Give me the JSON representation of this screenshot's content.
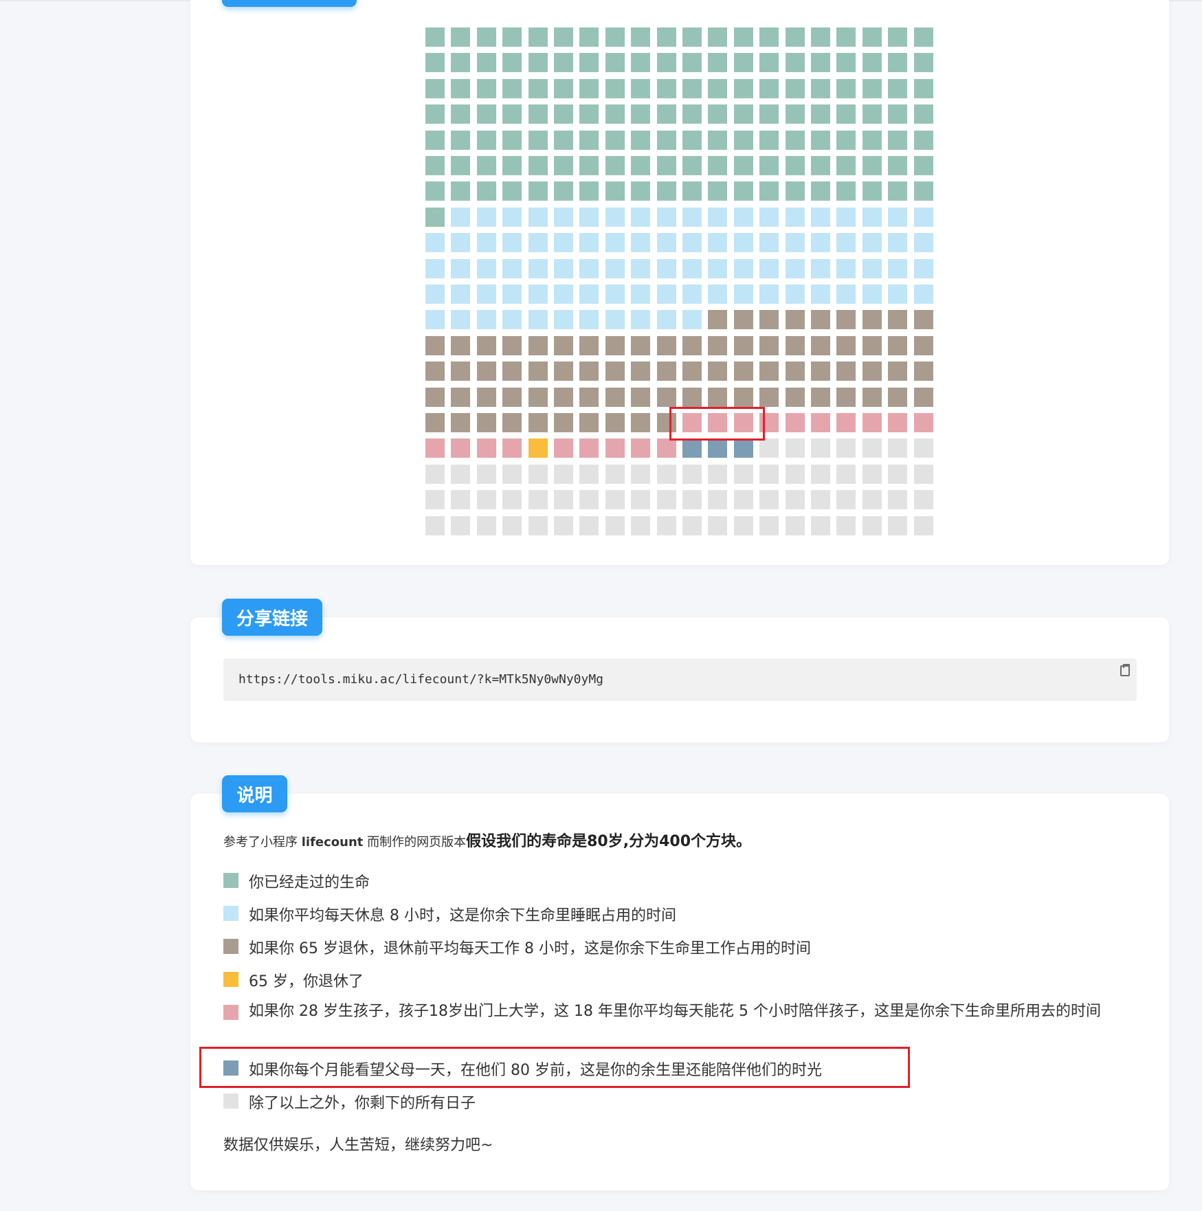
{
  "share": {
    "title": "分享链接",
    "url": "https://tools.miku.ac/lifecount/?k=MTk5Ny0wNy0yMg"
  },
  "description": {
    "title": "说明",
    "intro_prefix": "参考了小程序 ",
    "intro_app": "lifecount",
    "intro_middle": " 而制作的网页版本",
    "intro_strong": "假设我们的寿命是80岁,分为400个方块。",
    "legend": [
      {
        "label": "你已经走过的生命",
        "color": "#97c3b6"
      },
      {
        "label": "如果你平均每天休息 8 小时，这是你余下生命里睡眠占用的时间",
        "color": "#c0e5f6"
      },
      {
        "label": "如果你 65 岁退休，退休前平均每天工作 8 小时，这是你余下生命里工作占用的时间",
        "color": "#a99b8e"
      },
      {
        "label": "65 岁，你退休了",
        "color": "#f7bd3b"
      },
      {
        "label": "如果你 28 岁生孩子，孩子18岁出门上大学，这 18 年里你平均每天能花 5 个小时陪伴孩子，这里是你余下生命里所用去的时间",
        "color": "#e4a6ac"
      },
      {
        "label": "如果你每个月能看望父母一天，在他们 80 岁前，这是你的余生里还能陪伴他们的时光",
        "color": "#7c9db3"
      },
      {
        "label": "除了以上之外，你剩下的所有日子",
        "color": "#e2e2e2"
      }
    ],
    "footer": "数据仅供娱乐，人生苦短，继续努力吧~"
  },
  "grid": {
    "columns": 20,
    "total": 400,
    "palette": [
      "#97c3b6",
      "#c0e5f6",
      "#a99b8e",
      "#e4a6ac",
      "#7c9db3",
      "#e2e2e2",
      "#f7bd3b"
    ],
    "segments": [
      {
        "category": "lived",
        "count": 141
      },
      {
        "category": "sleep",
        "count": 90
      },
      {
        "category": "work",
        "count": 79
      },
      {
        "category": "kids",
        "count": 20
      },
      {
        "category": "parents",
        "count": 3
      },
      {
        "category": "remaining",
        "count": 67
      }
    ],
    "retirement_block": 324
  }
}
